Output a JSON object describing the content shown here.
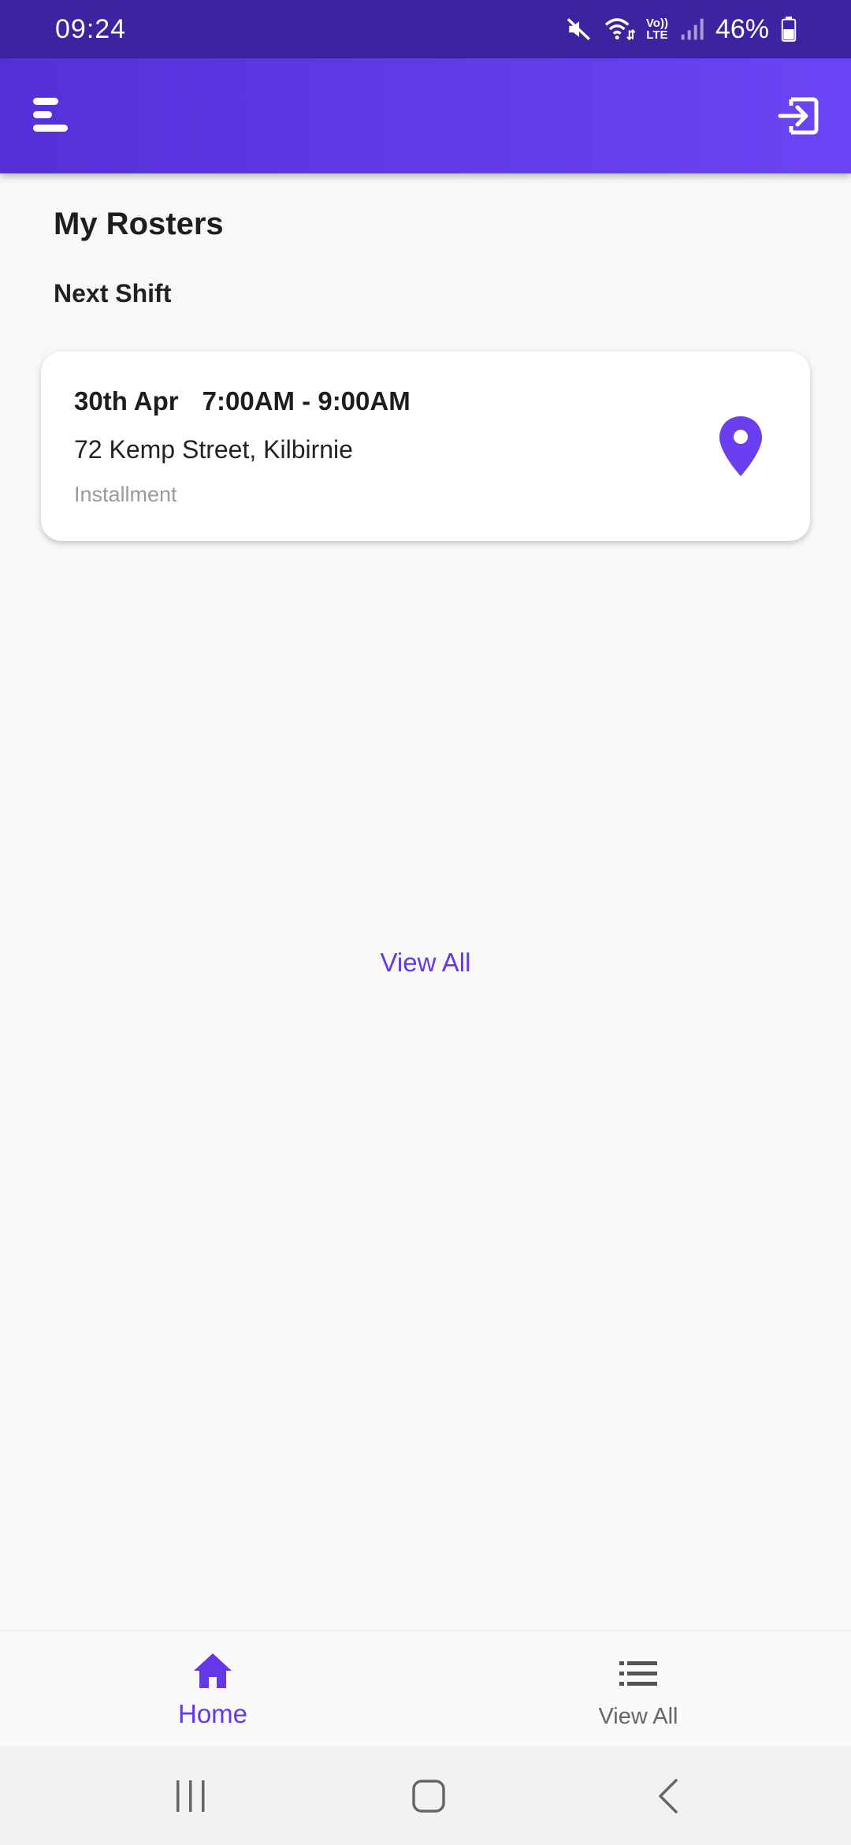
{
  "status_bar": {
    "time": "09:24",
    "battery": "46%",
    "network_label_top": "Vo))",
    "network_label_bottom": "LTE",
    "icons": [
      "mute-icon",
      "wifi-icon",
      "volte-icon",
      "signal-icon",
      "battery-icon"
    ]
  },
  "app_bar": {
    "menu_icon": "menu-icon",
    "logout_icon": "logout-icon",
    "background_start": "#5530d8",
    "background_end": "#6b45f5"
  },
  "page": {
    "title": "My Rosters",
    "section_title": "Next Shift"
  },
  "next_shift": {
    "date": "30th Apr",
    "time_range": "7:00AM - 9:00AM",
    "address": "72 Kemp Street, Kilbirnie",
    "type": "Installment",
    "pin_icon": "location-pin-icon"
  },
  "view_all_link": "View All",
  "bottom_nav": {
    "items": [
      {
        "label": "Home",
        "icon": "home-icon",
        "active": true
      },
      {
        "label": "View All",
        "icon": "list-icon",
        "active": false
      }
    ]
  },
  "colors": {
    "accent": "#6338e8",
    "status_bar": "#3c23a0",
    "background": "#f8f8f9"
  }
}
